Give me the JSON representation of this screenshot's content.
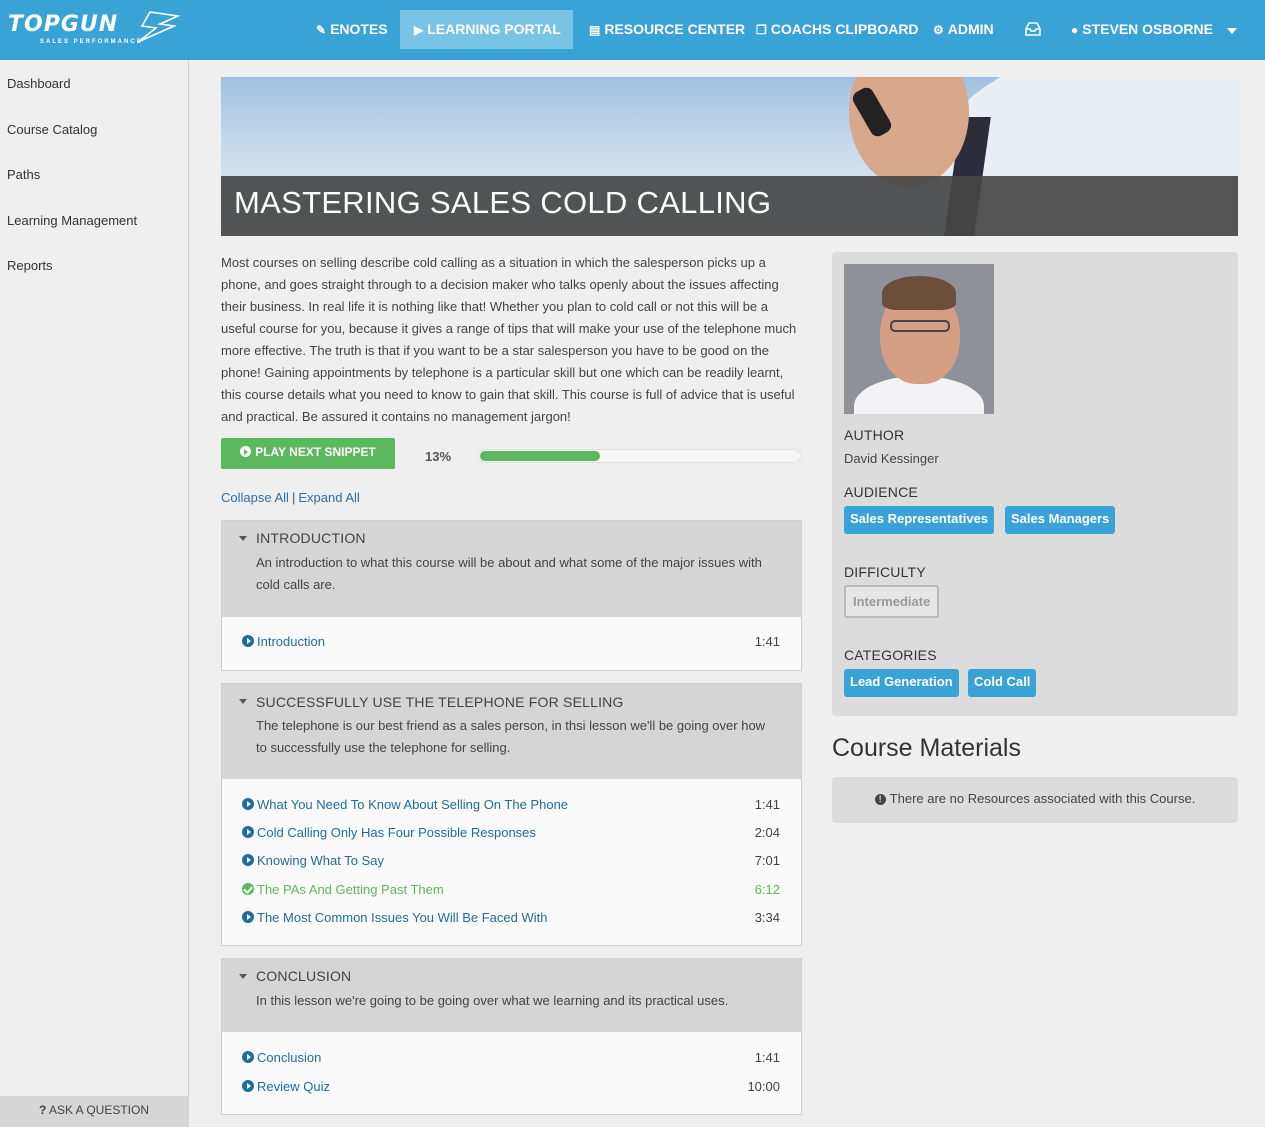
{
  "brand": {
    "name": "TOPGUN",
    "tagline": "SALES PERFORMANCE"
  },
  "nav": {
    "items": [
      {
        "label": "ENOTES",
        "icon": "pencil-icon"
      },
      {
        "label": "LEARNING PORTAL",
        "icon": "play-circle-icon",
        "active": true
      },
      {
        "label": "RESOURCE CENTER",
        "icon": "document-icon"
      },
      {
        "label": "COACHS CLIPBOARD",
        "icon": "clipboard-icon"
      },
      {
        "label": "ADMIN",
        "icon": "gears-icon"
      },
      {
        "label": "",
        "icon": "inbox-icon"
      },
      {
        "label": "STEVEN OSBORNE",
        "icon": "user-icon",
        "dropdown": true
      }
    ]
  },
  "sidebar": {
    "items": [
      {
        "label": "Dashboard"
      },
      {
        "label": "Course Catalog"
      },
      {
        "label": "Paths"
      },
      {
        "label": "Learning Management"
      },
      {
        "label": "Reports"
      }
    ],
    "ask_label": "ASK A QUESTION"
  },
  "course": {
    "title": "MASTERING SALES COLD CALLING",
    "description": "Most courses on selling describe cold calling as a situation in which the salesperson picks up a phone, and goes straight through to a decision maker who talks openly about the issues affecting their business. In real life it is nothing like that! Whether you plan to cold call or not this will be a useful course for you, because it gives a range of tips that will make your use of the telephone much more effective. The truth is that if you want to be a star salesperson you have to be good on the phone! Gaining appointments by telephone is a particular skill but one which can be readily learnt, this course details what you need to know to gain that skill. This course is full of advice that is useful and practical. Be assured it contains no management jargon!",
    "play_label": "PLAY NEXT SNIPPET",
    "progress_label": "13%",
    "progress_fraction": 0.13,
    "collapse_all": "Collapse All",
    "expand_all": "Expand All",
    "sep": "|"
  },
  "sections": [
    {
      "title": "INTRODUCTION",
      "description": "An introduction to what this course will be about and what some of the major issues with cold calls are.",
      "lessons": [
        {
          "title": "Introduction",
          "duration": "1:41",
          "completed": false
        }
      ]
    },
    {
      "title": "SUCCESSFULLY USE THE TELEPHONE FOR SELLING",
      "description": "The telephone is our best friend as a sales person, in thsi lesson we'll be going over how to successfully use the telephone for selling.",
      "lessons": [
        {
          "title": "What You Need To Know About Selling On The Phone",
          "duration": "1:41",
          "completed": false
        },
        {
          "title": "Cold Calling Only Has Four Possible Responses",
          "duration": "2:04",
          "completed": false
        },
        {
          "title": "Knowing What To Say",
          "duration": "7:01",
          "completed": false
        },
        {
          "title": "The PAs And Getting Past Them",
          "duration": "6:12",
          "completed": true
        },
        {
          "title": "The Most Common Issues You Will Be Faced With",
          "duration": "3:34",
          "completed": false
        }
      ]
    },
    {
      "title": "CONCLUSION",
      "description": "In this lesson we're going to be going over what we learning and its practical uses.",
      "lessons": [
        {
          "title": "Conclusion",
          "duration": "1:41",
          "completed": false
        },
        {
          "title": "Review Quiz",
          "duration": "10:00",
          "completed": false
        }
      ]
    }
  ],
  "info": {
    "author_label": "AUTHOR",
    "author_name": "David Kessinger",
    "audience_label": "AUDIENCE",
    "audience_tags": [
      "Sales Representatives",
      "Sales Managers"
    ],
    "difficulty_label": "DIFFICULTY",
    "difficulty": "Intermediate",
    "categories_label": "CATEGORIES",
    "category_tags": [
      "Lead Generation",
      "Cold Call"
    ]
  },
  "materials": {
    "title": "Course Materials",
    "empty_message": "There are no Resources associated with this Course."
  },
  "colors": {
    "nav_bg": "#3aa3d6",
    "accent_green": "#5cb85c",
    "link_blue": "#1e6d9e",
    "tag_blue": "#3aa3d6"
  }
}
